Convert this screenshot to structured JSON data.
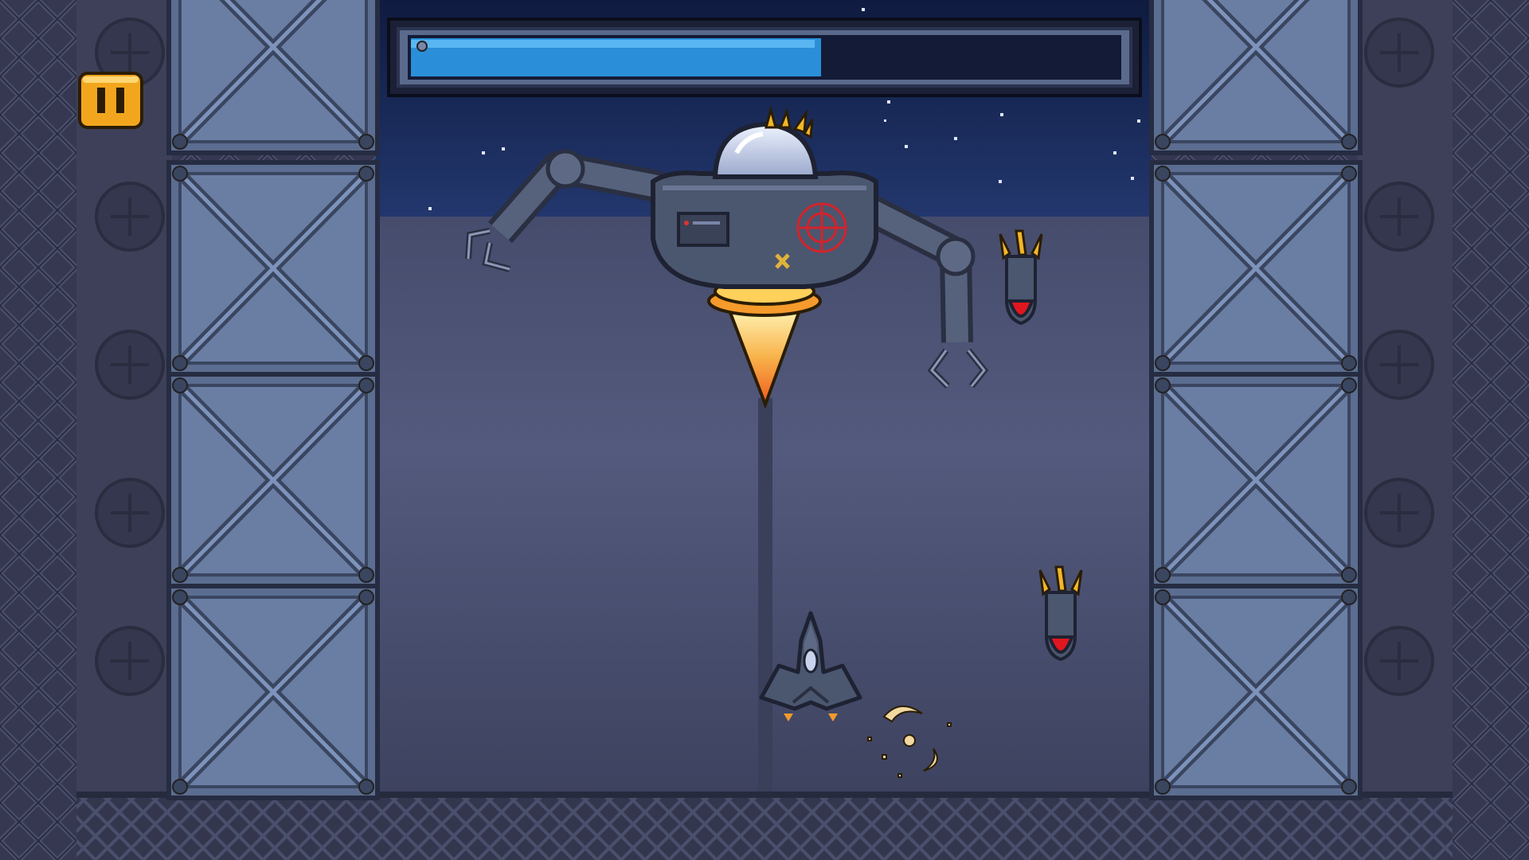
{
  "hud": {
    "pause_icon": "pause-icon",
    "boss_health": {
      "fraction": 0.58
    }
  },
  "colors": {
    "wall_dark": "#2e3046",
    "wall_mid": "#3b3f58",
    "lattice": "#4c5170",
    "girder_face": "#5d6f92",
    "girder_edge": "#2a3148",
    "sky_top": "#0f1b40",
    "sky_bottom": "#23386f",
    "floor_top": "#4e5474",
    "floor_bottom": "#3e4362",
    "health_fill": "#2a8fd8",
    "health_track": "#131b36",
    "pause_yellow": "#f2a61e",
    "flame_orange": "#f59a2c",
    "missile_tip": "#e0171f",
    "boss_body": "#4b566f",
    "boss_dome": "#c9d3ee"
  },
  "sprites": {
    "boss": "robot-boss",
    "player": "player-spaceship",
    "missiles": [
      "missile",
      "missile"
    ],
    "effects": [
      "explosion-debris"
    ]
  }
}
